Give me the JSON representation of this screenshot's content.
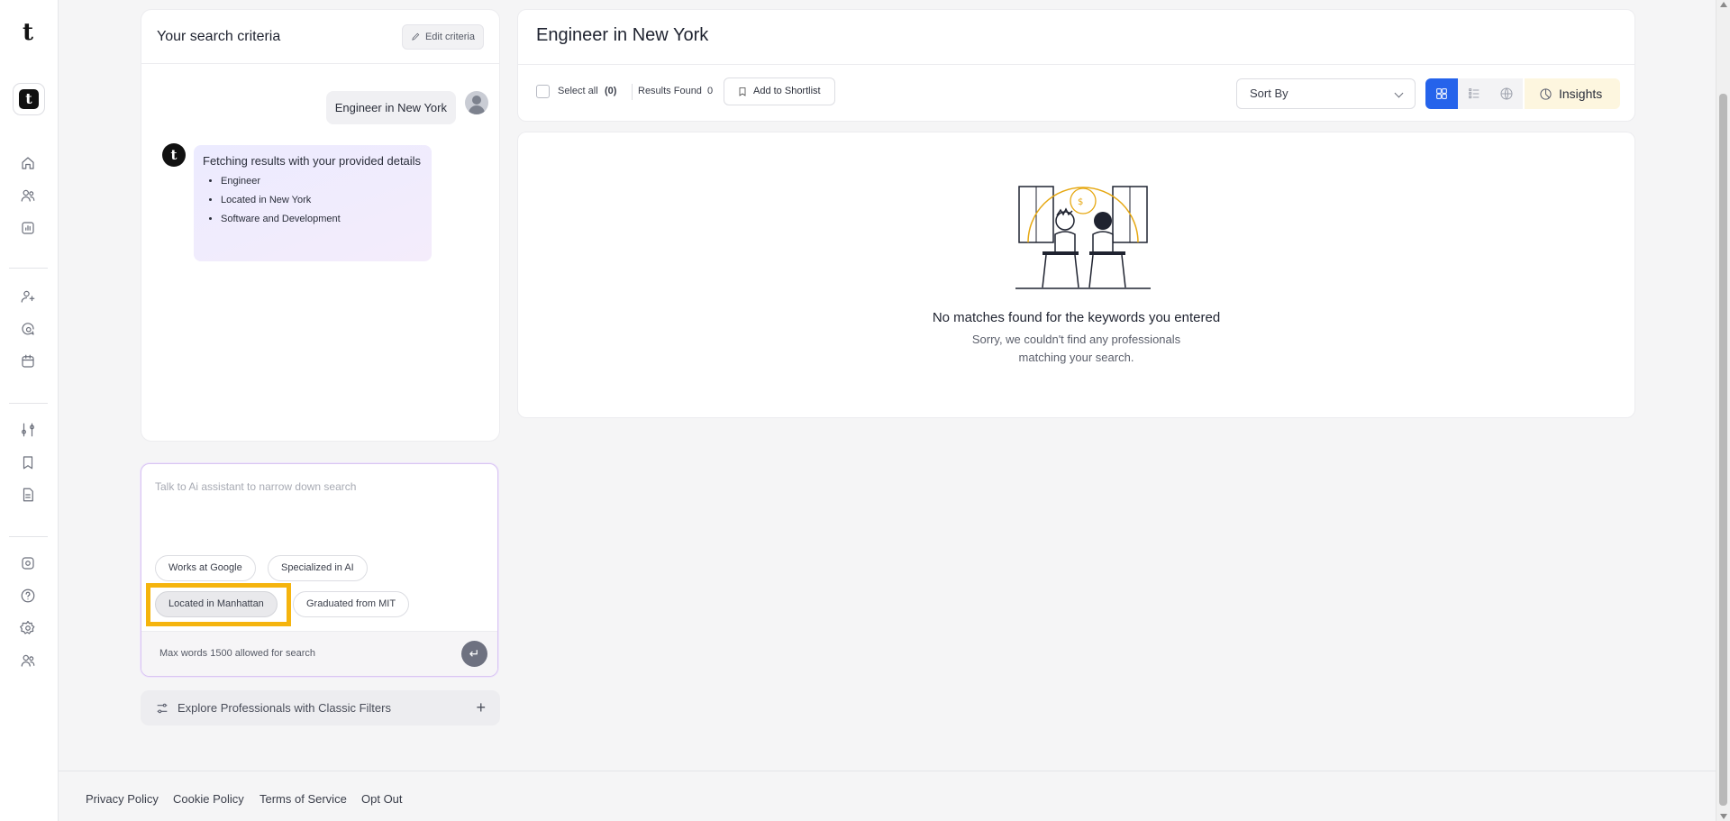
{
  "app": {
    "logo_letter": "t",
    "brand_letter": "t"
  },
  "sidebar": {
    "icons": [
      "home-icon",
      "people-icon",
      "analytics-icon",
      "add-user-icon",
      "chat-search-icon",
      "calendar-icon",
      "filters-icon",
      "bookmark-icon",
      "document-icon",
      "integrations-icon",
      "help-icon",
      "settings-icon",
      "team-icon"
    ]
  },
  "criteria": {
    "title": "Your search criteria",
    "edit_label": "Edit criteria",
    "user_query": "Engineer in New York",
    "bot_message": "Fetching results with your provided details",
    "bot_items": [
      "Engineer",
      "Located in New York",
      "Software and Development"
    ]
  },
  "assistant": {
    "placeholder": "Talk to Ai assistant to narrow down search",
    "suggestions": [
      "Works at Google",
      "Specialized in AI",
      "Located in Manhattan",
      "Graduated from MIT"
    ],
    "active_suggestion": "Located in Manhattan",
    "limit_note": "Max words 1500 allowed for search",
    "send_icon": "↵"
  },
  "explore": {
    "label": "Explore Professionals with Classic Filters",
    "plus": "+"
  },
  "results": {
    "title": "Engineer in New York",
    "select_all_label": "Select all",
    "selected_count": "(0)",
    "results_found_label": "Results Found",
    "results_found_value": "0",
    "shortlist_label": "Add to Shortlist",
    "sort_label": "Sort By",
    "insights_label": "Insights",
    "accent_color": "#2563eb"
  },
  "empty_state": {
    "title": "No matches found for the keywords you entered",
    "subtitle": "Sorry, we couldn't find any professionals matching your search."
  },
  "footer": {
    "links": [
      "Privacy Policy",
      "Cookie Policy",
      "Terms of Service",
      "Opt Out"
    ]
  }
}
